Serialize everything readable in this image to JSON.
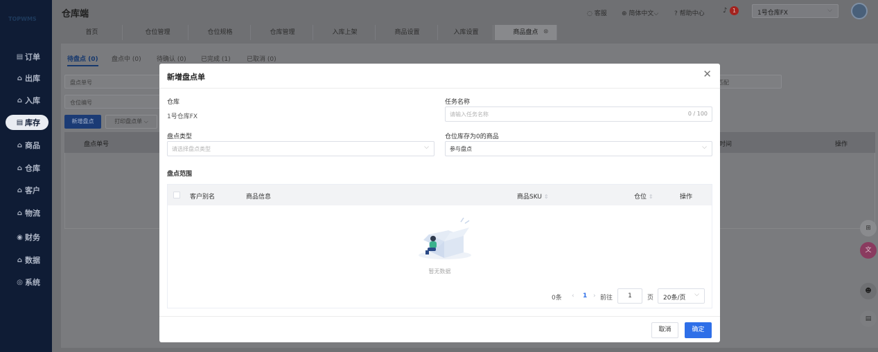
{
  "logo": "TOPWMS",
  "sidebar": {
    "items": [
      {
        "label": "订单",
        "icon": "▤"
      },
      {
        "label": "出库",
        "icon": "⌂"
      },
      {
        "label": "入库",
        "icon": "⌂"
      },
      {
        "label": "库存",
        "icon": "▤"
      },
      {
        "label": "商品",
        "icon": "⌂"
      },
      {
        "label": "仓库",
        "icon": "⌂"
      },
      {
        "label": "客户",
        "icon": "⌂"
      },
      {
        "label": "物流",
        "icon": "⌂"
      },
      {
        "label": "财务",
        "icon": "◉"
      },
      {
        "label": "数据",
        "icon": "⌂"
      },
      {
        "label": "系统",
        "icon": "◎"
      }
    ],
    "active_index": 3
  },
  "header": {
    "title": "仓库端",
    "service": "客服",
    "language": "简体中文",
    "help": "帮助中心",
    "notifications": "1",
    "warehouse": "1号仓库FX"
  },
  "tabs": [
    "首页",
    "仓位管理",
    "仓位规格",
    "仓库管理",
    "入库上架",
    "商品设置",
    "入库设置",
    "商品盘点"
  ],
  "active_tab": "商品盘点",
  "sub_tabs": [
    "待盘点 (0)",
    "盘点中 (0)",
    "待确认 (0)",
    "已完成 (1)",
    "已取消 (0)"
  ],
  "filters": {
    "count_no": "盘点单号",
    "location_no": "仓位编号",
    "right_filter": "匹配"
  },
  "background_actions": {
    "new": "新增盘点",
    "print": "打印盘点单"
  },
  "background_table": {
    "col1": "盘点单号",
    "col_time": "时间",
    "col_op": "操作"
  },
  "modal": {
    "title": "新增盘点单",
    "warehouse_label": "仓库",
    "warehouse_value": "1号仓库FX",
    "task_label": "任务名称",
    "task_placeholder": "请输入任务名称",
    "task_count": "0 / 100",
    "type_label": "盘点类型",
    "type_placeholder": "请选择盘点类型",
    "zero_label": "仓位库存为0的商品",
    "zero_value": "参与盘点",
    "scope_label": "盘点范围",
    "table": {
      "col_alias": "客户别名",
      "col_goods": "商品信息",
      "col_sku": "商品SKU",
      "col_location": "仓位",
      "col_op": "操作",
      "empty": "暂无数据"
    },
    "pager": {
      "total": "0条",
      "page": "1",
      "goto": "前往",
      "page_input": "1",
      "page_unit": "页",
      "size": "20条/页"
    },
    "cancel": "取消",
    "confirm": "确定"
  }
}
